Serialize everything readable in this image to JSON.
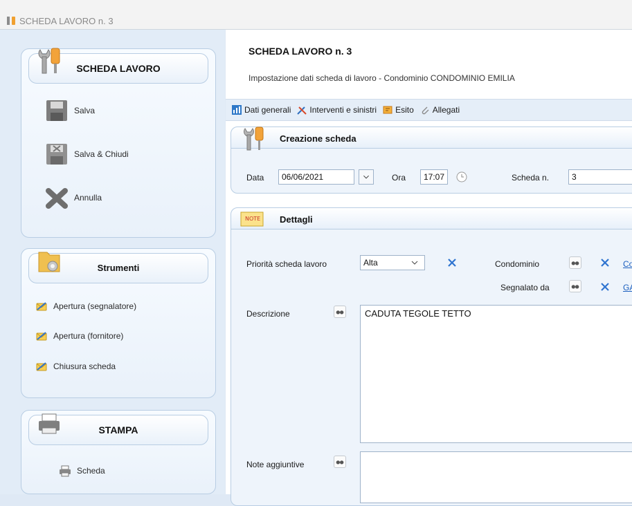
{
  "window": {
    "title": "SCHEDA LAVORO n. 3",
    "icon": "tools-icon"
  },
  "left_panel": {
    "scheda_group": {
      "title": "SCHEDA LAVORO",
      "icon": "tools-icon",
      "actions": [
        {
          "label": "Salva",
          "icon": "floppy-disk-icon"
        },
        {
          "label": "Salva & Chiudi",
          "icon": "floppy-disk-close-icon"
        },
        {
          "label": "Annulla",
          "icon": "cancel-x-icon"
        }
      ]
    },
    "strumenti_group": {
      "title": "Strumenti",
      "icon": "folder-gear-icon",
      "actions": [
        {
          "label": "Apertura (segnalatore)",
          "icon": "envelope-icon"
        },
        {
          "label": "Apertura (fornitore)",
          "icon": "envelope-icon"
        },
        {
          "label": "Chiusura scheda",
          "icon": "envelope-icon"
        }
      ]
    },
    "stampa_group": {
      "title": "STAMPA",
      "icon": "printer-icon",
      "actions": [
        {
          "label": "Scheda",
          "icon": "printer-icon"
        }
      ]
    }
  },
  "main": {
    "title": "SCHEDA LAVORO n. 3",
    "subtitle": "Impostazione dati scheda di lavoro - Condominio CONDOMINIO EMILIA",
    "toolbar": [
      {
        "label": "Dati generali",
        "icon": "chart-icon"
      },
      {
        "label": "Interventi e sinistri",
        "icon": "tools-icon"
      },
      {
        "label": "Esito",
        "icon": "flag-icon"
      },
      {
        "label": "Allegati",
        "icon": "paperclip-icon"
      }
    ],
    "creazione": {
      "title": "Creazione scheda",
      "data_label": "Data",
      "data_value": "06/06/2021",
      "ora_label": "Ora",
      "ora_value": "17:07",
      "scheda_label": "Scheda n.",
      "scheda_value": "3"
    },
    "dettagli": {
      "title": "Dettagli",
      "priorita_label": "Priorità scheda lavoro",
      "priorita_value": "Alta",
      "condominio_label": "Condominio",
      "condominio_link": "Co",
      "segnalato_label": "Segnalato da",
      "segnalato_link": "GA",
      "descrizione_label": "Descrizione",
      "descrizione_value": "CADUTA TEGOLE TETTO",
      "note_label": "Note aggiuntive",
      "note_value": ""
    }
  },
  "colors": {
    "accent_blue": "#1c5fbf",
    "panel_bg": "#e2ecf7",
    "border": "#b8cde3"
  }
}
